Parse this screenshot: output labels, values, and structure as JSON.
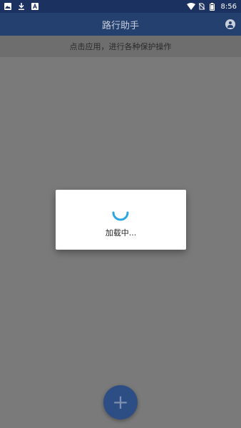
{
  "status_bar": {
    "time": "8:56",
    "left_icons": [
      "image-icon",
      "download-icon",
      "text-icon"
    ],
    "right_icons": [
      "wifi-icon",
      "no-sim-icon",
      "battery-icon"
    ]
  },
  "app_bar": {
    "title": "路行助手",
    "account_icon": "account-circle-icon"
  },
  "hint": {
    "text": "点击应用，进行各种保护操作"
  },
  "dialog": {
    "loading_text": "加载中..."
  },
  "fab": {
    "icon": "plus-icon",
    "label": "+"
  },
  "colors": {
    "status_bar": "#1b3260",
    "app_bar": "#23406f",
    "overlay_background": "#7a7a7a",
    "spinner": "#2aa7e0",
    "fab": "#2d4d85"
  }
}
